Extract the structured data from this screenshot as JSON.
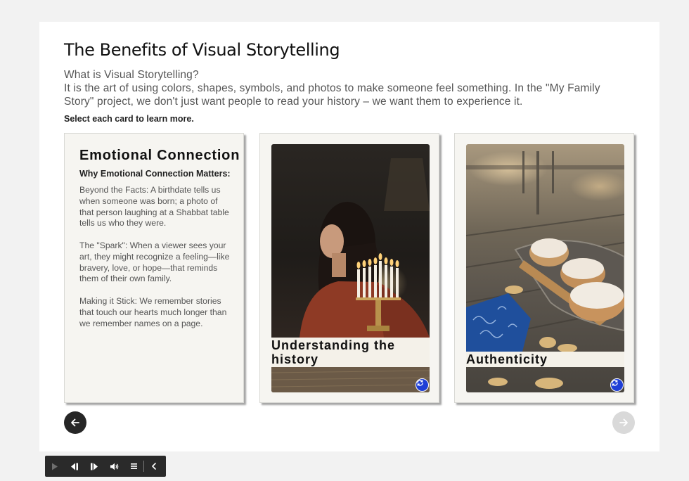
{
  "page": {
    "title": "The Benefits of Visual Storytelling",
    "intro_question": "What is Visual Storytelling?",
    "intro_text": "It is the art of using colors, shapes, symbols, and photos to make someone feel something. In the \"My Family Story\" project, we don't just want people to read your history – we want them to experience it.",
    "instruction": "Select each card to learn more."
  },
  "cards": [
    {
      "heading": "Emotional Connection",
      "subheading": "Why Emotional Connection Matters:",
      "paragraphs": [
        "Beyond the Facts: A birthdate tells us when someone was born; a photo of that person laughing at a Shabbat table tells us who they were.",
        "The \"Spark\": When a viewer sees your art, they might recognize a feeling—like bravery, love, or hope—that reminds them of their own family.",
        "Making it Stick: We remember stories that touch our hearts much longer than we remember names on a page."
      ]
    },
    {
      "caption": "Understanding the history",
      "icon": "flip-icon"
    },
    {
      "caption": "Authenticity",
      "icon": "flip-icon"
    }
  ],
  "navigation": {
    "prev_icon": "arrow-left-icon",
    "next_icon": "arrow-right-icon"
  },
  "playbar": {
    "icons": [
      "play-icon",
      "previous-slide-icon",
      "next-slide-icon",
      "volume-icon",
      "menu-icon",
      "collapse-icon"
    ]
  },
  "colors": {
    "card_bg": "#f6f5f1",
    "flip_button": "#1f3fd6",
    "nav_prev": "#262626",
    "nav_next_disabled": "#d9d9d9",
    "playbar_bg": "#2a2a2a"
  }
}
